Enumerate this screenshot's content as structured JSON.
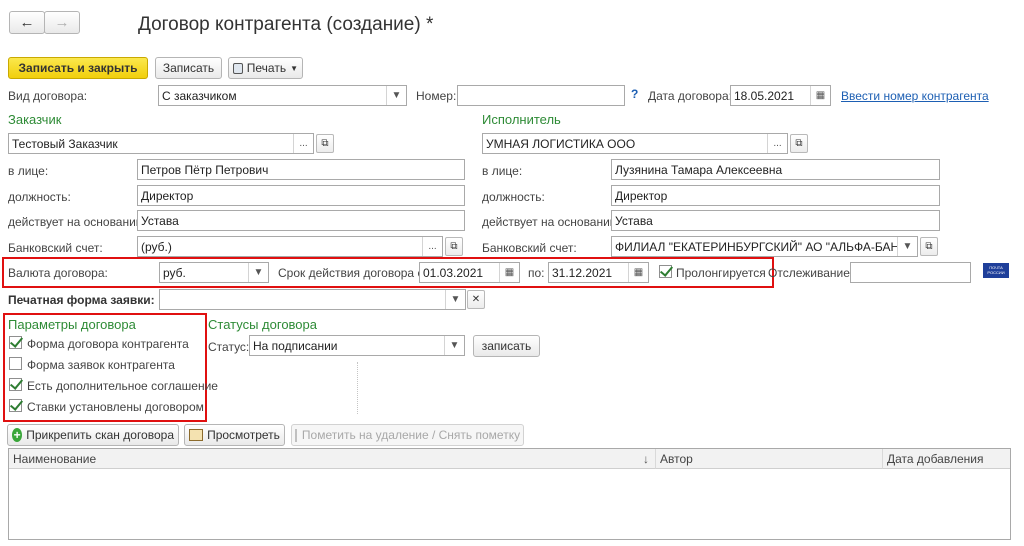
{
  "window": {
    "title": "Договор контрагента (создание) *"
  },
  "toolbar": {
    "save_close": "Записать и закрыть",
    "save": "Записать",
    "print": "Печать"
  },
  "header_row": {
    "contract_type_label": "Вид договора:",
    "contract_type_value": "С заказчиком",
    "number_label": "Номер:",
    "number_value": "",
    "help": "?",
    "date_label": "Дата договора:",
    "date_value": "18.05.2021",
    "enter_number_link": "Ввести номер контрагента"
  },
  "customer": {
    "title": "Заказчик",
    "name": "Тестовый Заказчик",
    "person_label": "в лице:",
    "person": "Петров Пётр Петрович",
    "position_label": "должность:",
    "position": "Директор",
    "basis_label": "действует на основании:",
    "basis": "Устава",
    "bank_label": "Банковский счет:",
    "bank": "(руб.)"
  },
  "executor": {
    "title": "Исполнитель",
    "name": "УМНАЯ ЛОГИСТИКА ООО",
    "person_label": "в лице:",
    "person": "Лузянина Тамара Алексеевна",
    "position_label": "должность:",
    "position": "Директор",
    "basis_label": "действует на основании:",
    "basis": "Устава",
    "bank_label": "Банковский счет:",
    "bank": "ФИЛИАЛ \"ЕКАТЕРИНБУРГСКИЙ\" АО \"АЛЬФА-БАНК\""
  },
  "terms": {
    "currency_label": "Валюта договора:",
    "currency": "руб.",
    "period_label": "Срок действия договора с:",
    "date_from": "01.03.2021",
    "to_label": "по:",
    "date_to": "31.12.2021",
    "prolong_label": "Пролонгируется",
    "tracking_label": "Отслеживание:",
    "tracking_value": "",
    "post_logo": "ПОЧТА РОССИИ"
  },
  "print_form": {
    "label": "Печатная форма заявки:",
    "value": ""
  },
  "params": {
    "title": "Параметры договора",
    "items": [
      {
        "label": "Форма договора контрагента",
        "checked": true
      },
      {
        "label": "Форма заявок контрагента",
        "checked": false
      },
      {
        "label": "Есть дополнительное соглашение",
        "checked": true
      },
      {
        "label": "Ставки установлены договором",
        "checked": true
      }
    ]
  },
  "statuses": {
    "title": "Статусы договора",
    "status_label": "Статус:",
    "status_value": "На подписании",
    "save_button": "записать"
  },
  "attachments": {
    "attach_button": "Прикрепить скан договора",
    "view_button": "Просмотреть",
    "delete_button": "Пометить на удаление / Снять пометку",
    "columns": [
      "Наименование",
      "Автор",
      "Дата добавления"
    ],
    "sort_indicator": "↓"
  },
  "colors": {
    "accent_green": "#2e8b36",
    "highlight_red": "#e01010",
    "primary_yellow": "#f1cf0c",
    "link_blue": "#1d5fb3"
  }
}
